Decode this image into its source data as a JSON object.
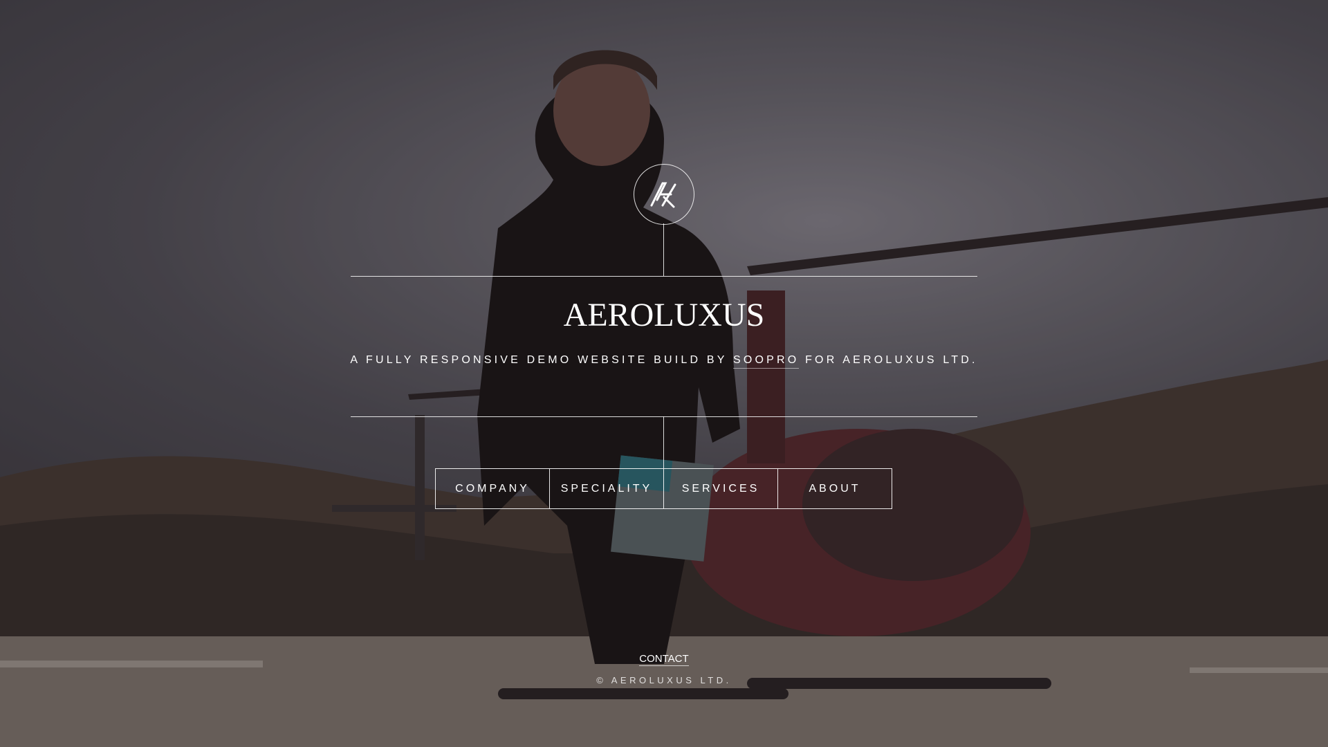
{
  "logo": {
    "icon": "aeroluxus-monogram-icon"
  },
  "brand": {
    "name": "AEROLUXUS"
  },
  "tagline": {
    "prefix": "A FULLY RESPONSIVE DEMO WEBSITE BUILD BY ",
    "link": "SOOPRO",
    "suffix": " FOR AEROLUXUS LTD."
  },
  "nav": {
    "items": [
      {
        "label": "COMPANY"
      },
      {
        "label": "SPECIALITY"
      },
      {
        "label": "SERVICES"
      },
      {
        "label": "ABOUT"
      }
    ]
  },
  "footer": {
    "contact": "CONTACT",
    "copyright": "© AEROLUXUS LTD."
  },
  "colors": {
    "text": "#ffffff",
    "overlay": "#1a181c"
  }
}
